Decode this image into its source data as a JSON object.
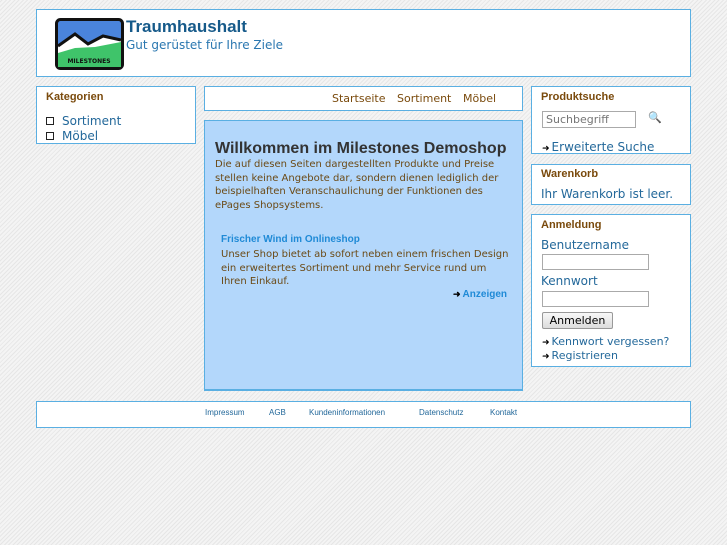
{
  "header": {
    "logo_text": "MILESTONES",
    "title": "Traumhaushalt",
    "slogan": "Gut gerüstet für Ihre Ziele"
  },
  "categories": {
    "title": "Kategorien",
    "items": [
      "Sortiment",
      "Möbel"
    ]
  },
  "nav": [
    "Startseite",
    "Sortiment",
    "Möbel"
  ],
  "main": {
    "title": "Willkommen im Milestones Demoshop",
    "intro": "Die auf diesen Seiten dargestellten Produkte und Preise stellen keine Angebote dar, sondern dienen lediglich der beispielhaften Veranschaulichung der Funktionen des ePages Shopsystems.",
    "teaser_title": "Frischer Wind im Onlineshop",
    "teaser_text": "Unser Shop bietet ab sofort neben einem frischen Design ein erweitertes Sortiment und mehr Service rund um Ihren Einkauf.",
    "more": "Anzeigen"
  },
  "search": {
    "title": "Produktsuche",
    "placeholder": "Suchbegriff",
    "advanced": "Erweiterte Suche"
  },
  "cart": {
    "title": "Warenkorb",
    "empty": "Ihr Warenkorb ist leer."
  },
  "login": {
    "title": "Anmeldung",
    "user_label": "Benutzername",
    "pass_label": "Kennwort",
    "button": "Anmelden",
    "forgot": "Kennwort vergessen?",
    "register": "Registrieren"
  },
  "footer": [
    "Impressum",
    "AGB",
    "Kundeninformationen",
    "Datenschutz",
    "Kontakt"
  ]
}
